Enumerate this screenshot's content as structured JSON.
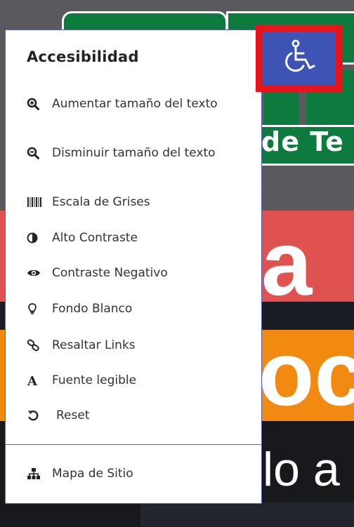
{
  "panel": {
    "title": "Accesibilidad",
    "items": [
      {
        "icon": "zoom-in-icon",
        "label": "Aumentar tamaño del texto"
      },
      {
        "icon": "zoom-out-icon",
        "label": "Disminuir tamaño del texto"
      },
      {
        "icon": "barcode-icon",
        "label": "Escala de Grises"
      },
      {
        "icon": "half-circle-icon",
        "label": "Alto Contraste"
      },
      {
        "icon": "eye-icon",
        "label": "Contraste Negativo"
      },
      {
        "icon": "lightbulb-icon",
        "label": "Fondo Blanco"
      },
      {
        "icon": "link-icon",
        "label": "Resaltar Links"
      },
      {
        "icon": "font-icon",
        "label": "Fuente legible"
      },
      {
        "icon": "undo-icon",
        "label": "Reset"
      }
    ],
    "footer_item": {
      "icon": "sitemap-icon",
      "label": "Mapa de Sitio"
    }
  },
  "background": {
    "banner_text": "de Te",
    "big_text_red": "a",
    "big_text_orange": "oc",
    "bottom_text": "lo a"
  },
  "colors": {
    "panel_border": "#5560b5",
    "button_bg": "#3e54b4",
    "button_outline": "#e8141c",
    "accent_green": "#0d7a3e",
    "accent_red": "#e0524f",
    "accent_orange": "#f28a12"
  }
}
